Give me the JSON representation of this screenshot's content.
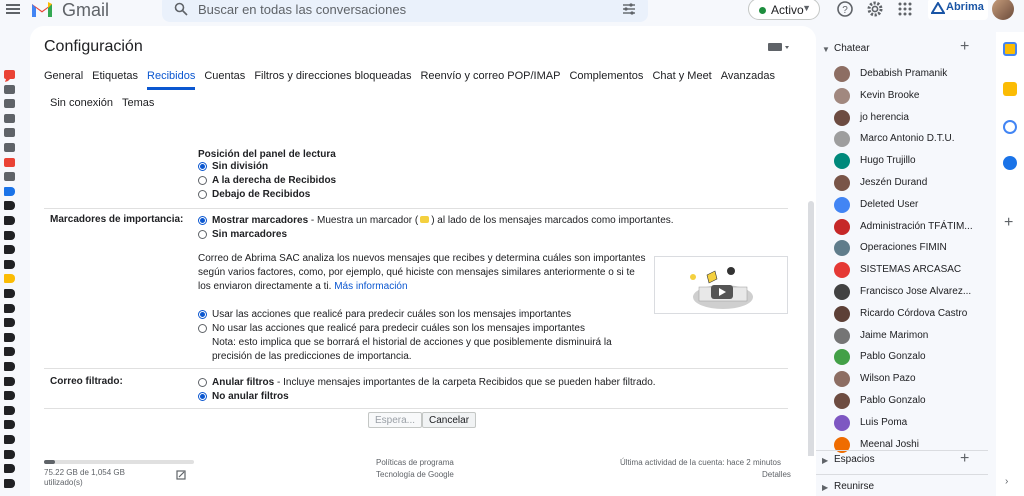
{
  "app": {
    "name": "Gmail"
  },
  "search": {
    "placeholder": "Buscar en todas las conversaciones"
  },
  "status": {
    "label": "Activo",
    "color": "#1e8e3e"
  },
  "brand": {
    "name": "Abrima"
  },
  "settings": {
    "title": "Configuración",
    "tabs": [
      "General",
      "Etiquetas",
      "Recibidos",
      "Cuentas",
      "Filtros y direcciones bloqueadas",
      "Reenvío y correo POP/IMAP",
      "Complementos",
      "Chat y Meet",
      "Avanzadas"
    ],
    "tabs_row2": [
      "Sin conexión",
      "Temas"
    ],
    "active_tab": "Recibidos",
    "reading_pane_header": "Posición del panel de lectura",
    "reading_pane_options": [
      "Sin división",
      "A la derecha de Recibidos",
      "Debajo de Recibidos"
    ],
    "importance": {
      "label": "Marcadores de importancia:",
      "show": "Mostrar marcadores",
      "show_desc_a": " - Muestra un marcador (",
      "show_desc_b": ") al lado de los mensajes marcados como importantes.",
      "hide": "Sin marcadores",
      "desc1": "Correo de Abrima SAC analiza los nuevos mensajes que recibes y determina cuáles son importantes",
      "desc2": "según varios factores, como, por ejemplo, qué hiciste con mensajes similares anteriormente o si te",
      "desc3": "los enviaron directamente a ti.",
      "more": "Más información",
      "use_actions": "Usar las acciones que realicé para predecir cuáles son los mensajes importantes",
      "no_actions": "No usar las acciones que realicé para predecir cuáles son los mensajes importantes",
      "note1": "Nota: esto implica que se borrará el historial de acciones y que posiblemente disminuirá la",
      "note2": "precisión de las predicciones de importancia."
    },
    "filtered": {
      "label": "Correo filtrado:",
      "override": "Anular filtros",
      "override_desc": " - Incluye mensajes importantes de la carpeta Recibidos que se pueden haber filtrado.",
      "no_override": "No anular filtros"
    },
    "buttons": {
      "save": "Espera...",
      "cancel": "Cancelar"
    }
  },
  "footer": {
    "storage_line1": "75.22 GB de 1,054 GB",
    "storage_line2": "utilizado(s)",
    "storage_fraction": 0.07,
    "policies1": "Políticas de programa",
    "policies2": "Tecnología de Google",
    "activity1": "Última actividad de la cuenta: hace 2 minutos",
    "activity2": "Detalles"
  },
  "chat": {
    "header": "Chatear",
    "contacts": [
      {
        "name": "Debabish Pramanik",
        "color": "#8d6e63"
      },
      {
        "name": "Kevin Brooke",
        "color": "#a1887f"
      },
      {
        "name": "jo herencia",
        "color": "#6d4c41"
      },
      {
        "name": "Marco Antonio D.T.U.",
        "color": "#9e9e9e"
      },
      {
        "name": "Hugo Trujillo",
        "color": "#00897b"
      },
      {
        "name": "Jeszén Durand",
        "color": "#795548"
      },
      {
        "name": "Deleted User",
        "color": "#4285f4"
      },
      {
        "name": "Administración TFÁTIM...",
        "color": "#c62828"
      },
      {
        "name": "Operaciones FIMIN",
        "color": "#607d8b"
      },
      {
        "name": "SISTEMAS ARCASAC",
        "color": "#e53935"
      },
      {
        "name": "Francisco Jose Alvarez...",
        "color": "#424242"
      },
      {
        "name": "Ricardo Córdova Castro",
        "color": "#5d4037"
      },
      {
        "name": "Jaime Marimon",
        "color": "#757575"
      },
      {
        "name": "Pablo Gonzalo",
        "color": "#43a047"
      },
      {
        "name": "Wilson Pazo",
        "color": "#8d6e63"
      },
      {
        "name": "Pablo Gonzalo",
        "color": "#6d4c41"
      },
      {
        "name": "Luis Poma",
        "color": "#7e57c2"
      },
      {
        "name": "Meenal Joshi",
        "color": "#ef6c00"
      }
    ],
    "spaces": "Espacios",
    "meetings": "Reunirse"
  }
}
